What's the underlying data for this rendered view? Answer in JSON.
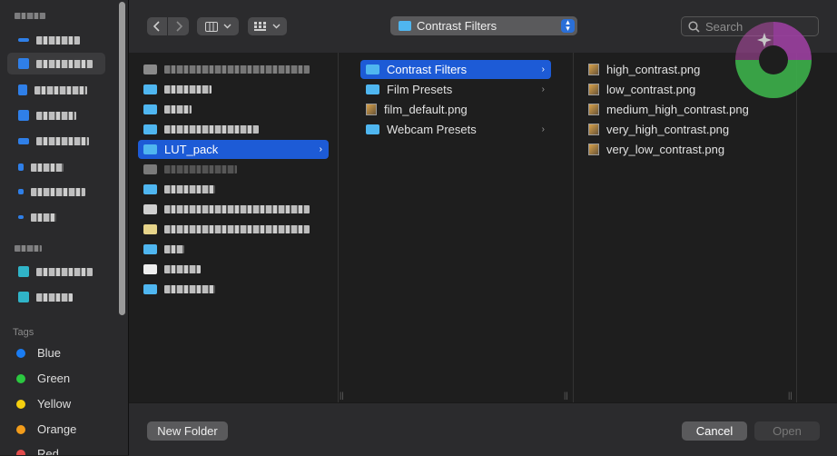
{
  "sidebar": {
    "favorites_heading": "Favorites",
    "locations_heading": "Locations",
    "tags_title": "Tags",
    "tags": [
      {
        "label": "Blue",
        "color": "#1a7cf2"
      },
      {
        "label": "Green",
        "color": "#2bc840"
      },
      {
        "label": "Yellow",
        "color": "#f5cf0f"
      },
      {
        "label": "Orange",
        "color": "#f29c1b"
      },
      {
        "label": "Red",
        "color": "#e24c4c"
      }
    ]
  },
  "toolbar": {
    "back_icon": "chevron-left-icon",
    "forward_icon": "chevron-right-icon",
    "view_icon": "column-view-icon",
    "group_icon": "grid-icon",
    "path_label": "Contrast Filters",
    "search_placeholder": "Search"
  },
  "columns": {
    "first": {
      "selected_label": "LUT_pack"
    },
    "second": {
      "items": [
        {
          "label": "Contrast Filters",
          "kind": "folder",
          "selected": true
        },
        {
          "label": "Film Presets",
          "kind": "folder"
        },
        {
          "label": "film_default.png",
          "kind": "image"
        },
        {
          "label": "Webcam Presets",
          "kind": "folder"
        }
      ]
    },
    "third": {
      "items": [
        {
          "label": "high_contrast.png"
        },
        {
          "label": "low_contrast.png"
        },
        {
          "label": "medium_high_contrast.png"
        },
        {
          "label": "very_high_contrast.png"
        },
        {
          "label": "very_low_contrast.png"
        }
      ]
    }
  },
  "footer": {
    "new_folder_label": "New Folder",
    "cancel_label": "Cancel",
    "open_label": "Open"
  },
  "colors": {
    "accent": "#1d5bd6",
    "folder": "#4fb6f0"
  }
}
